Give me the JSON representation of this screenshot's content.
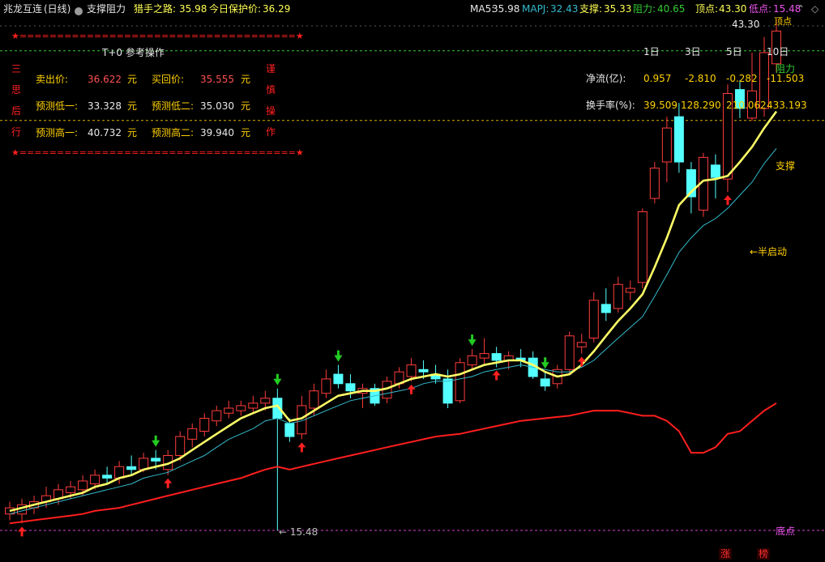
{
  "header": {
    "stock_name": "兆龙互连",
    "period": "(日线)",
    "indicator_name": "支撑阻力",
    "hunter_label": "猎手之路:",
    "hunter_value": "35.98",
    "protect_label": "今日保护价:",
    "protect_value": "36.29",
    "ma5_label": "MA5:",
    "ma5_value": "35.98",
    "mapj_label": "MAPJ:",
    "mapj_value": "32.43",
    "support_label": "支撑:",
    "support_value": "35.33",
    "resist_label": "阻力:",
    "resist_value": "40.65",
    "top_label": "顶点:",
    "top_value": "43.30",
    "bottom_label": "低点:",
    "bottom_value": "15.48"
  },
  "panel": {
    "stars_line": "★=====================================★",
    "title": "T+0 参考操作",
    "left_vertical": [
      "三",
      "思",
      "后",
      "行"
    ],
    "right_vertical": [
      "谨",
      "慎",
      "操",
      "作"
    ],
    "sell_label": "卖出价:",
    "sell_value": "36.622",
    "buy_label": "买回价:",
    "buy_value": "35.555",
    "low1_label": "预测低一:",
    "low1_value": "33.328",
    "low2_label": "预测低二:",
    "low2_value": "35.030",
    "high1_label": "预测高一:",
    "high1_value": "40.732",
    "high2_label": "预测高二:",
    "high2_value": "39.940",
    "unit": "元"
  },
  "flow": {
    "periods": [
      "1日",
      "3日",
      "5日",
      "10日"
    ],
    "net_label": "净流(亿):",
    "net_values": [
      "0.957",
      "-2.810",
      "-0.282",
      "-11.503"
    ],
    "turnover_label": "换手率(%):",
    "turnover_values": [
      "39.509",
      "128.290",
      "210.062",
      "433.193"
    ]
  },
  "annotations": {
    "top_price": "43.30",
    "top_text": "顶点",
    "resist_text": "阻力",
    "support_text": "支撑",
    "half_start_text": "←半启动",
    "bottom_text": "底点",
    "low_price": "15.48",
    "zhang": "涨",
    "bang": "榜"
  },
  "colors": {
    "up": "#ff3c3c",
    "down": "#54ffff",
    "ma_yellow": "#ffff66",
    "mapj_cyan": "#33bbcc",
    "white_line": "#e8e8e8",
    "support_red": "#ff1e1e",
    "resist_green": "#33cc33",
    "support_dash": "#d8b000",
    "bottom_purple": "#d040d0",
    "panel_red": "#ff2020",
    "panel_value": "#ffd000"
  },
  "chart_data": {
    "type": "candlestick",
    "ylim": [
      15,
      44
    ],
    "top": 43.3,
    "low": 15.48,
    "resist_level": 40.65,
    "support_level": 35.33,
    "candles": [
      {
        "o": 16.0,
        "h": 16.4,
        "l": 15.8,
        "c": 16.2
      },
      {
        "o": 16.0,
        "h": 16.5,
        "l": 15.7,
        "c": 16.3
      },
      {
        "o": 16.2,
        "h": 16.6,
        "l": 16.0,
        "c": 16.4
      },
      {
        "o": 16.4,
        "h": 16.9,
        "l": 16.2,
        "c": 16.6
      },
      {
        "o": 16.5,
        "h": 17.0,
        "l": 16.3,
        "c": 16.8
      },
      {
        "o": 16.7,
        "h": 17.1,
        "l": 16.5,
        "c": 16.9
      },
      {
        "o": 16.8,
        "h": 17.3,
        "l": 16.6,
        "c": 17.1
      },
      {
        "o": 17.0,
        "h": 17.5,
        "l": 16.8,
        "c": 17.3
      },
      {
        "o": 17.3,
        "h": 17.6,
        "l": 17.0,
        "c": 17.2
      },
      {
        "o": 17.2,
        "h": 17.8,
        "l": 17.0,
        "c": 17.6
      },
      {
        "o": 17.6,
        "h": 18.0,
        "l": 17.3,
        "c": 17.5
      },
      {
        "o": 17.5,
        "h": 18.1,
        "l": 17.4,
        "c": 17.9
      },
      {
        "o": 17.9,
        "h": 18.2,
        "l": 17.5,
        "c": 17.8
      },
      {
        "o": 17.5,
        "h": 18.2,
        "l": 17.3,
        "c": 18.0
      },
      {
        "o": 18.0,
        "h": 18.9,
        "l": 17.8,
        "c": 18.7
      },
      {
        "o": 18.6,
        "h": 19.2,
        "l": 18.3,
        "c": 19.0
      },
      {
        "o": 18.9,
        "h": 19.6,
        "l": 18.7,
        "c": 19.4
      },
      {
        "o": 19.3,
        "h": 19.9,
        "l": 19.1,
        "c": 19.7
      },
      {
        "o": 19.6,
        "h": 20.1,
        "l": 19.4,
        "c": 19.8
      },
      {
        "o": 19.7,
        "h": 20.1,
        "l": 19.5,
        "c": 19.9
      },
      {
        "o": 19.8,
        "h": 20.3,
        "l": 19.6,
        "c": 20.0
      },
      {
        "o": 20.0,
        "h": 20.5,
        "l": 19.7,
        "c": 20.2
      },
      {
        "o": 20.2,
        "h": 20.6,
        "l": 15.48,
        "c": 19.4
      },
      {
        "o": 19.2,
        "h": 19.4,
        "l": 18.5,
        "c": 18.7
      },
      {
        "o": 18.8,
        "h": 20.3,
        "l": 18.6,
        "c": 19.9
      },
      {
        "o": 19.8,
        "h": 20.8,
        "l": 19.5,
        "c": 20.5
      },
      {
        "o": 20.4,
        "h": 21.4,
        "l": 20.2,
        "c": 21.0
      },
      {
        "o": 21.2,
        "h": 21.6,
        "l": 20.6,
        "c": 20.8
      },
      {
        "o": 20.8,
        "h": 21.2,
        "l": 20.2,
        "c": 20.5
      },
      {
        "o": 20.4,
        "h": 20.8,
        "l": 19.8,
        "c": 20.6
      },
      {
        "o": 20.6,
        "h": 20.8,
        "l": 19.9,
        "c": 20.0
      },
      {
        "o": 20.2,
        "h": 21.1,
        "l": 20.0,
        "c": 20.9
      },
      {
        "o": 20.8,
        "h": 21.5,
        "l": 20.6,
        "c": 21.3
      },
      {
        "o": 21.1,
        "h": 21.9,
        "l": 20.9,
        "c": 21.6
      },
      {
        "o": 21.4,
        "h": 21.8,
        "l": 21.0,
        "c": 21.3
      },
      {
        "o": 21.2,
        "h": 21.6,
        "l": 20.8,
        "c": 21.0
      },
      {
        "o": 21.0,
        "h": 21.4,
        "l": 19.8,
        "c": 20.0
      },
      {
        "o": 20.1,
        "h": 21.9,
        "l": 20.0,
        "c": 21.7
      },
      {
        "o": 21.6,
        "h": 22.3,
        "l": 21.4,
        "c": 22.0
      },
      {
        "o": 21.9,
        "h": 22.8,
        "l": 21.6,
        "c": 22.1
      },
      {
        "o": 22.1,
        "h": 22.4,
        "l": 21.5,
        "c": 21.8
      },
      {
        "o": 21.8,
        "h": 22.2,
        "l": 21.4,
        "c": 22.0
      },
      {
        "o": 21.9,
        "h": 22.3,
        "l": 21.5,
        "c": 21.8
      },
      {
        "o": 21.9,
        "h": 22.2,
        "l": 21.0,
        "c": 21.1
      },
      {
        "o": 21.0,
        "h": 21.3,
        "l": 20.5,
        "c": 20.7
      },
      {
        "o": 20.8,
        "h": 21.6,
        "l": 20.6,
        "c": 21.4
      },
      {
        "o": 21.4,
        "h": 23.1,
        "l": 21.2,
        "c": 22.9
      },
      {
        "o": 22.4,
        "h": 23.0,
        "l": 22.1,
        "c": 22.6
      },
      {
        "o": 22.8,
        "h": 25.0,
        "l": 22.6,
        "c": 24.6
      },
      {
        "o": 24.4,
        "h": 25.2,
        "l": 23.6,
        "c": 24.0
      },
      {
        "o": 24.2,
        "h": 25.8,
        "l": 24.0,
        "c": 25.4
      },
      {
        "o": 25.0,
        "h": 25.6,
        "l": 24.6,
        "c": 25.2
      },
      {
        "o": 25.5,
        "h": 29.6,
        "l": 25.2,
        "c": 29.4
      },
      {
        "o": 30.2,
        "h": 32.5,
        "l": 29.9,
        "c": 32.1
      },
      {
        "o": 32.5,
        "h": 35.6,
        "l": 31.2,
        "c": 34.8
      },
      {
        "o": 35.6,
        "h": 36.6,
        "l": 31.8,
        "c": 32.5
      },
      {
        "o": 32.0,
        "h": 32.5,
        "l": 29.3,
        "c": 30.3
      },
      {
        "o": 29.5,
        "h": 33.1,
        "l": 29.1,
        "c": 32.8
      },
      {
        "o": 32.3,
        "h": 33.0,
        "l": 30.2,
        "c": 31.5
      },
      {
        "o": 31.4,
        "h": 38.0,
        "l": 30.6,
        "c": 37.3
      },
      {
        "o": 37.6,
        "h": 38.3,
        "l": 35.5,
        "c": 36.2
      },
      {
        "o": 35.5,
        "h": 40.5,
        "l": 35.3,
        "c": 37.5
      },
      {
        "o": 36.2,
        "h": 41.8,
        "l": 35.6,
        "c": 40.5
      },
      {
        "o": 39.6,
        "h": 43.3,
        "l": 38.9,
        "c": 42.3
      }
    ],
    "ma_support_yellow": [
      16.1,
      16.2,
      16.3,
      16.4,
      16.5,
      16.6,
      16.7,
      16.9,
      17.0,
      17.2,
      17.3,
      17.5,
      17.6,
      17.7,
      17.9,
      18.2,
      18.5,
      18.8,
      19.1,
      19.4,
      19.6,
      19.8,
      19.9,
      19.3,
      19.4,
      19.7,
      20.0,
      20.3,
      20.4,
      20.5,
      20.5,
      20.6,
      20.8,
      21.0,
      21.1,
      21.2,
      21.1,
      21.2,
      21.4,
      21.6,
      21.7,
      21.8,
      21.8,
      21.6,
      21.3,
      21.1,
      21.2,
      21.6,
      22.2,
      22.9,
      23.6,
      24.2,
      24.9,
      26.3,
      27.9,
      29.8,
      30.6,
      31.3,
      31.4,
      31.6,
      32.5,
      33.5,
      34.8,
      35.98
    ],
    "mapj_cyan": [
      16.0,
      16.1,
      16.2,
      16.3,
      16.4,
      16.5,
      16.6,
      16.7,
      16.8,
      16.9,
      17.0,
      17.2,
      17.3,
      17.4,
      17.6,
      17.8,
      18.0,
      18.3,
      18.6,
      18.8,
      19.0,
      19.3,
      19.4,
      19.2,
      19.3,
      19.5,
      19.7,
      19.9,
      20.1,
      20.2,
      20.3,
      20.4,
      20.5,
      20.6,
      20.8,
      20.9,
      20.9,
      21.0,
      21.1,
      21.3,
      21.4,
      21.5,
      21.6,
      21.5,
      21.4,
      21.3,
      21.3,
      21.5,
      21.8,
      22.3,
      22.8,
      23.3,
      23.8,
      24.8,
      25.9,
      27.1,
      27.9,
      28.6,
      29.0,
      29.6,
      30.4,
      31.2,
      32.4,
      33.4
    ],
    "red_support_line": [
      15.7,
      15.75,
      15.8,
      15.85,
      15.9,
      15.95,
      16.0,
      16.1,
      16.15,
      16.2,
      16.3,
      16.4,
      16.5,
      16.6,
      16.7,
      16.8,
      16.9,
      17.0,
      17.1,
      17.2,
      17.35,
      17.5,
      17.6,
      17.5,
      17.6,
      17.7,
      17.8,
      17.9,
      18.0,
      18.1,
      18.2,
      18.3,
      18.4,
      18.5,
      18.6,
      18.7,
      18.75,
      18.8,
      18.9,
      19.0,
      19.1,
      19.2,
      19.3,
      19.35,
      19.4,
      19.45,
      19.5,
      19.6,
      19.7,
      19.7,
      19.7,
      19.6,
      19.5,
      19.5,
      19.3,
      18.9,
      18.1,
      18.1,
      18.3,
      18.8,
      18.9,
      19.3,
      19.7,
      20.0
    ],
    "down_arrows": [
      12,
      22,
      27,
      38,
      44
    ],
    "up_arrows": [
      1,
      13,
      24,
      33,
      40,
      47,
      59
    ]
  }
}
